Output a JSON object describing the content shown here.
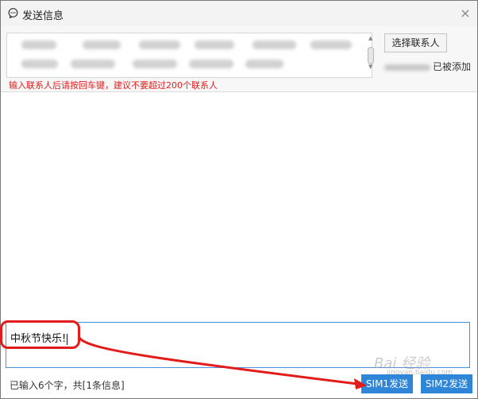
{
  "window": {
    "title": "发送信息",
    "close_glyph": "×"
  },
  "recipients": {
    "select_contact_label": "选择联系人",
    "added_suffix": "已被添加",
    "hint": "输入联系人后请按回车键，建议不要超过200个联系人"
  },
  "compose": {
    "text": "中秋节快乐!"
  },
  "footer": {
    "status": "已输入6个字，共[1条信息]",
    "sim1_label": "SIM1发送",
    "sim2_label": "SIM2发送"
  },
  "watermark": {
    "main": "Bai 经验",
    "sub": "jingyan.baidu.com"
  },
  "colors": {
    "accent": "#2f86d8",
    "hint_red": "#e02020",
    "annotation_red": "#e21b1b"
  }
}
